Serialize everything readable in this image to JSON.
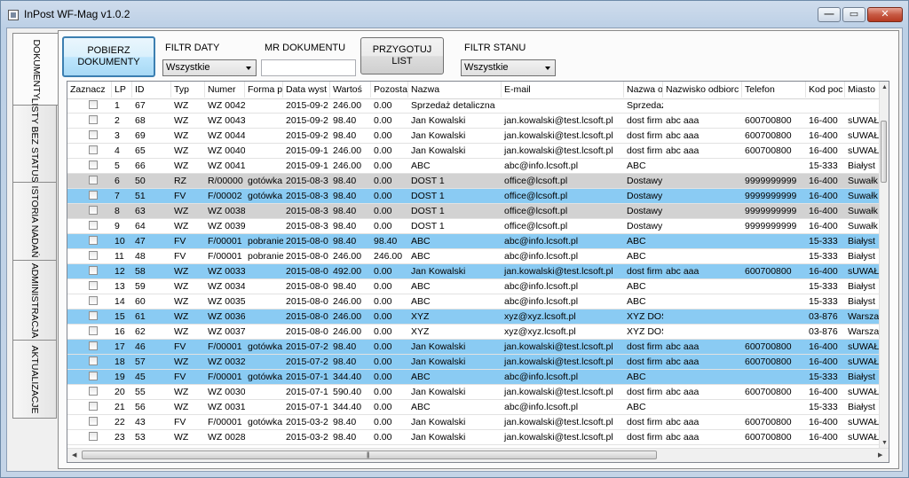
{
  "window": {
    "title": "InPost WF-Mag v1.0.2",
    "min_glyph": "—",
    "max_glyph": "▭",
    "close_glyph": "✕"
  },
  "tabs": [
    "DOKUMENTY",
    "LISTY BEZ STATUSU",
    "ISTORIA NADAŃ",
    "ADMINISTRACJA",
    "AKTUALIZACJE"
  ],
  "toolbar": {
    "fetch_button": "POBIERZ DOKUMENTY",
    "date_filter_label": "FILTR DATY",
    "date_filter_value": "Wszystkie",
    "mr_label": "MR DOKUMENTU",
    "mr_value": "",
    "prepare_button": "PRZYGOTUJ LIST",
    "state_filter_label": "FILTR STANU",
    "state_filter_value": "Wszystkie"
  },
  "grid": {
    "columns": [
      "Zaznacz",
      "LP",
      "ID",
      "Typ",
      "Numer",
      "Forma p",
      "Data wyst",
      "Wartoś",
      "Pozosta",
      "Nazwa",
      "E-mail",
      "Nazwa o",
      "Nazwisko odbiorc",
      "Telefon",
      "Kod poc",
      "Miasto"
    ],
    "rows": [
      {
        "lp": "1",
        "id": "67",
        "typ": "WZ",
        "numer": "WZ 0042",
        "forma": "",
        "data": "2015-09-2",
        "wartosc": "246.00",
        "pozostalo": "0.00",
        "nazwa": "Sprzedaż detaliczna",
        "email": "",
        "nazwa_odb": "Sprzedaż",
        "nazwisko": "",
        "telefon": "",
        "kod": "",
        "miasto": "",
        "style": "white"
      },
      {
        "lp": "2",
        "id": "68",
        "typ": "WZ",
        "numer": "WZ 0043",
        "forma": "",
        "data": "2015-09-2",
        "wartosc": "98.40",
        "pozostalo": "0.00",
        "nazwa": "Jan Kowalski",
        "email": "jan.kowalski@test.lcsoft.pl",
        "nazwa_odb": "dost firm",
        "nazwisko": "abc  aaa",
        "telefon": "600700800",
        "kod": "16-400",
        "miasto": "sUWAŁ",
        "style": "white"
      },
      {
        "lp": "3",
        "id": "69",
        "typ": "WZ",
        "numer": "WZ 0044",
        "forma": "",
        "data": "2015-09-2",
        "wartosc": "98.40",
        "pozostalo": "0.00",
        "nazwa": "Jan Kowalski",
        "email": "jan.kowalski@test.lcsoft.pl",
        "nazwa_odb": "dost firm",
        "nazwisko": "abc  aaa",
        "telefon": "600700800",
        "kod": "16-400",
        "miasto": "sUWAŁ",
        "style": "white"
      },
      {
        "lp": "4",
        "id": "65",
        "typ": "WZ",
        "numer": "WZ 0040",
        "forma": "",
        "data": "2015-09-1",
        "wartosc": "246.00",
        "pozostalo": "0.00",
        "nazwa": "Jan Kowalski",
        "email": "jan.kowalski@test.lcsoft.pl",
        "nazwa_odb": "dost firm",
        "nazwisko": "abc  aaa",
        "telefon": "600700800",
        "kod": "16-400",
        "miasto": "sUWAŁ",
        "style": "white"
      },
      {
        "lp": "5",
        "id": "66",
        "typ": "WZ",
        "numer": "WZ 0041",
        "forma": "",
        "data": "2015-09-1",
        "wartosc": "246.00",
        "pozostalo": "0.00",
        "nazwa": "ABC",
        "email": "abc@info.lcsoft.pl",
        "nazwa_odb": "ABC",
        "nazwisko": "",
        "telefon": "",
        "kod": "15-333",
        "miasto": "Białyst",
        "style": "white"
      },
      {
        "lp": "6",
        "id": "50",
        "typ": "RZ",
        "numer": "R/00000",
        "forma": "gotówka",
        "data": "2015-08-3",
        "wartosc": "98.40",
        "pozostalo": "0.00",
        "nazwa": "DOST 1",
        "email": "office@lcsoft.pl",
        "nazwa_odb": "Dostawy",
        "nazwisko": "",
        "telefon": "9999999999",
        "kod": "16-400",
        "miasto": "Suwałk",
        "style": "gray"
      },
      {
        "lp": "7",
        "id": "51",
        "typ": "FV",
        "numer": "F/00002",
        "forma": "gotówka",
        "data": "2015-08-3",
        "wartosc": "98.40",
        "pozostalo": "0.00",
        "nazwa": "DOST 1",
        "email": "office@lcsoft.pl",
        "nazwa_odb": "Dostawy",
        "nazwisko": "",
        "telefon": "9999999999",
        "kod": "16-400",
        "miasto": "Suwałk",
        "style": "blue"
      },
      {
        "lp": "8",
        "id": "63",
        "typ": "WZ",
        "numer": "WZ 0038",
        "forma": "",
        "data": "2015-08-3",
        "wartosc": "98.40",
        "pozostalo": "0.00",
        "nazwa": "DOST 1",
        "email": "office@lcsoft.pl",
        "nazwa_odb": "Dostawy",
        "nazwisko": "",
        "telefon": "9999999999",
        "kod": "16-400",
        "miasto": "Suwałk",
        "style": "gray"
      },
      {
        "lp": "9",
        "id": "64",
        "typ": "WZ",
        "numer": "WZ 0039",
        "forma": "",
        "data": "2015-08-3",
        "wartosc": "98.40",
        "pozostalo": "0.00",
        "nazwa": "DOST 1",
        "email": "office@lcsoft.pl",
        "nazwa_odb": "Dostawy",
        "nazwisko": "",
        "telefon": "9999999999",
        "kod": "16-400",
        "miasto": "Suwałk",
        "style": "white"
      },
      {
        "lp": "10",
        "id": "47",
        "typ": "FV",
        "numer": "F/00001",
        "forma": "pobranie",
        "data": "2015-08-0",
        "wartosc": "98.40",
        "pozostalo": "98.40",
        "nazwa": "ABC",
        "email": "abc@info.lcsoft.pl",
        "nazwa_odb": "ABC",
        "nazwisko": "",
        "telefon": "",
        "kod": "15-333",
        "miasto": "Białyst",
        "style": "blue"
      },
      {
        "lp": "11",
        "id": "48",
        "typ": "FV",
        "numer": "F/00001",
        "forma": "pobranie",
        "data": "2015-08-0",
        "wartosc": "246.00",
        "pozostalo": "246.00",
        "nazwa": "ABC",
        "email": "abc@info.lcsoft.pl",
        "nazwa_odb": "ABC",
        "nazwisko": "",
        "telefon": "",
        "kod": "15-333",
        "miasto": "Białyst",
        "style": "white"
      },
      {
        "lp": "12",
        "id": "58",
        "typ": "WZ",
        "numer": "WZ 0033",
        "forma": "",
        "data": "2015-08-0",
        "wartosc": "492.00",
        "pozostalo": "0.00",
        "nazwa": "Jan Kowalski",
        "email": "jan.kowalski@test.lcsoft.pl",
        "nazwa_odb": "dost firm",
        "nazwisko": "abc  aaa",
        "telefon": "600700800",
        "kod": "16-400",
        "miasto": "sUWAŁ",
        "style": "blue"
      },
      {
        "lp": "13",
        "id": "59",
        "typ": "WZ",
        "numer": "WZ 0034",
        "forma": "",
        "data": "2015-08-0",
        "wartosc": "98.40",
        "pozostalo": "0.00",
        "nazwa": "ABC",
        "email": "abc@info.lcsoft.pl",
        "nazwa_odb": "ABC",
        "nazwisko": "",
        "telefon": "",
        "kod": "15-333",
        "miasto": "Białyst",
        "style": "white"
      },
      {
        "lp": "14",
        "id": "60",
        "typ": "WZ",
        "numer": "WZ 0035",
        "forma": "",
        "data": "2015-08-0",
        "wartosc": "246.00",
        "pozostalo": "0.00",
        "nazwa": "ABC",
        "email": "abc@info.lcsoft.pl",
        "nazwa_odb": "ABC",
        "nazwisko": "",
        "telefon": "",
        "kod": "15-333",
        "miasto": "Białyst",
        "style": "white"
      },
      {
        "lp": "15",
        "id": "61",
        "typ": "WZ",
        "numer": "WZ 0036",
        "forma": "",
        "data": "2015-08-0",
        "wartosc": "246.00",
        "pozostalo": "0.00",
        "nazwa": "XYZ",
        "email": "xyz@xyz.lcsoft.pl",
        "nazwa_odb": "XYZ DOS",
        "nazwisko": "",
        "telefon": "",
        "kod": "03-876",
        "miasto": "Warsza",
        "style": "blue"
      },
      {
        "lp": "16",
        "id": "62",
        "typ": "WZ",
        "numer": "WZ 0037",
        "forma": "",
        "data": "2015-08-0",
        "wartosc": "246.00",
        "pozostalo": "0.00",
        "nazwa": "XYZ",
        "email": "xyz@xyz.lcsoft.pl",
        "nazwa_odb": "XYZ DOS",
        "nazwisko": "",
        "telefon": "",
        "kod": "03-876",
        "miasto": "Warsza",
        "style": "white"
      },
      {
        "lp": "17",
        "id": "46",
        "typ": "FV",
        "numer": "F/00001",
        "forma": "gotówka",
        "data": "2015-07-2",
        "wartosc": "98.40",
        "pozostalo": "0.00",
        "nazwa": "Jan Kowalski",
        "email": "jan.kowalski@test.lcsoft.pl",
        "nazwa_odb": "dost firm",
        "nazwisko": "abc  aaa",
        "telefon": "600700800",
        "kod": "16-400",
        "miasto": "sUWAŁ",
        "style": "blue"
      },
      {
        "lp": "18",
        "id": "57",
        "typ": "WZ",
        "numer": "WZ 0032",
        "forma": "",
        "data": "2015-07-2",
        "wartosc": "98.40",
        "pozostalo": "0.00",
        "nazwa": "Jan Kowalski",
        "email": "jan.kowalski@test.lcsoft.pl",
        "nazwa_odb": "dost firm",
        "nazwisko": "abc  aaa",
        "telefon": "600700800",
        "kod": "16-400",
        "miasto": "sUWAŁ",
        "style": "blue"
      },
      {
        "lp": "19",
        "id": "45",
        "typ": "FV",
        "numer": "F/00001",
        "forma": "gotówka",
        "data": "2015-07-1",
        "wartosc": "344.40",
        "pozostalo": "0.00",
        "nazwa": "ABC",
        "email": "abc@info.lcsoft.pl",
        "nazwa_odb": "ABC",
        "nazwisko": "",
        "telefon": "",
        "kod": "15-333",
        "miasto": "Białyst",
        "style": "blue"
      },
      {
        "lp": "20",
        "id": "55",
        "typ": "WZ",
        "numer": "WZ 0030",
        "forma": "",
        "data": "2015-07-1",
        "wartosc": "590.40",
        "pozostalo": "0.00",
        "nazwa": "Jan Kowalski",
        "email": "jan.kowalski@test.lcsoft.pl",
        "nazwa_odb": "dost firm",
        "nazwisko": "abc  aaa",
        "telefon": "600700800",
        "kod": "16-400",
        "miasto": "sUWAŁ",
        "style": "white"
      },
      {
        "lp": "21",
        "id": "56",
        "typ": "WZ",
        "numer": "WZ 0031",
        "forma": "",
        "data": "2015-07-1",
        "wartosc": "344.40",
        "pozostalo": "0.00",
        "nazwa": "ABC",
        "email": "abc@info.lcsoft.pl",
        "nazwa_odb": "ABC",
        "nazwisko": "",
        "telefon": "",
        "kod": "15-333",
        "miasto": "Białyst",
        "style": "white"
      },
      {
        "lp": "22",
        "id": "43",
        "typ": "FV",
        "numer": "F/00001",
        "forma": "gotówka",
        "data": "2015-03-2",
        "wartosc": "98.40",
        "pozostalo": "0.00",
        "nazwa": "Jan Kowalski",
        "email": "jan.kowalski@test.lcsoft.pl",
        "nazwa_odb": "dost firm",
        "nazwisko": "abc  aaa",
        "telefon": "600700800",
        "kod": "16-400",
        "miasto": "sUWAŁ",
        "style": "white"
      },
      {
        "lp": "23",
        "id": "53",
        "typ": "WZ",
        "numer": "WZ 0028",
        "forma": "",
        "data": "2015-03-2",
        "wartosc": "98.40",
        "pozostalo": "0.00",
        "nazwa": "Jan Kowalski",
        "email": "jan.kowalski@test.lcsoft.pl",
        "nazwa_odb": "dost firm",
        "nazwisko": "abc  aaa",
        "telefon": "600700800",
        "kod": "16-400",
        "miasto": "sUWAŁ",
        "style": "white"
      }
    ]
  },
  "colors": {
    "selected_row": "#8acbf3",
    "gray_row": "#d2d2d2",
    "focus_border": "#3c7fb1"
  }
}
